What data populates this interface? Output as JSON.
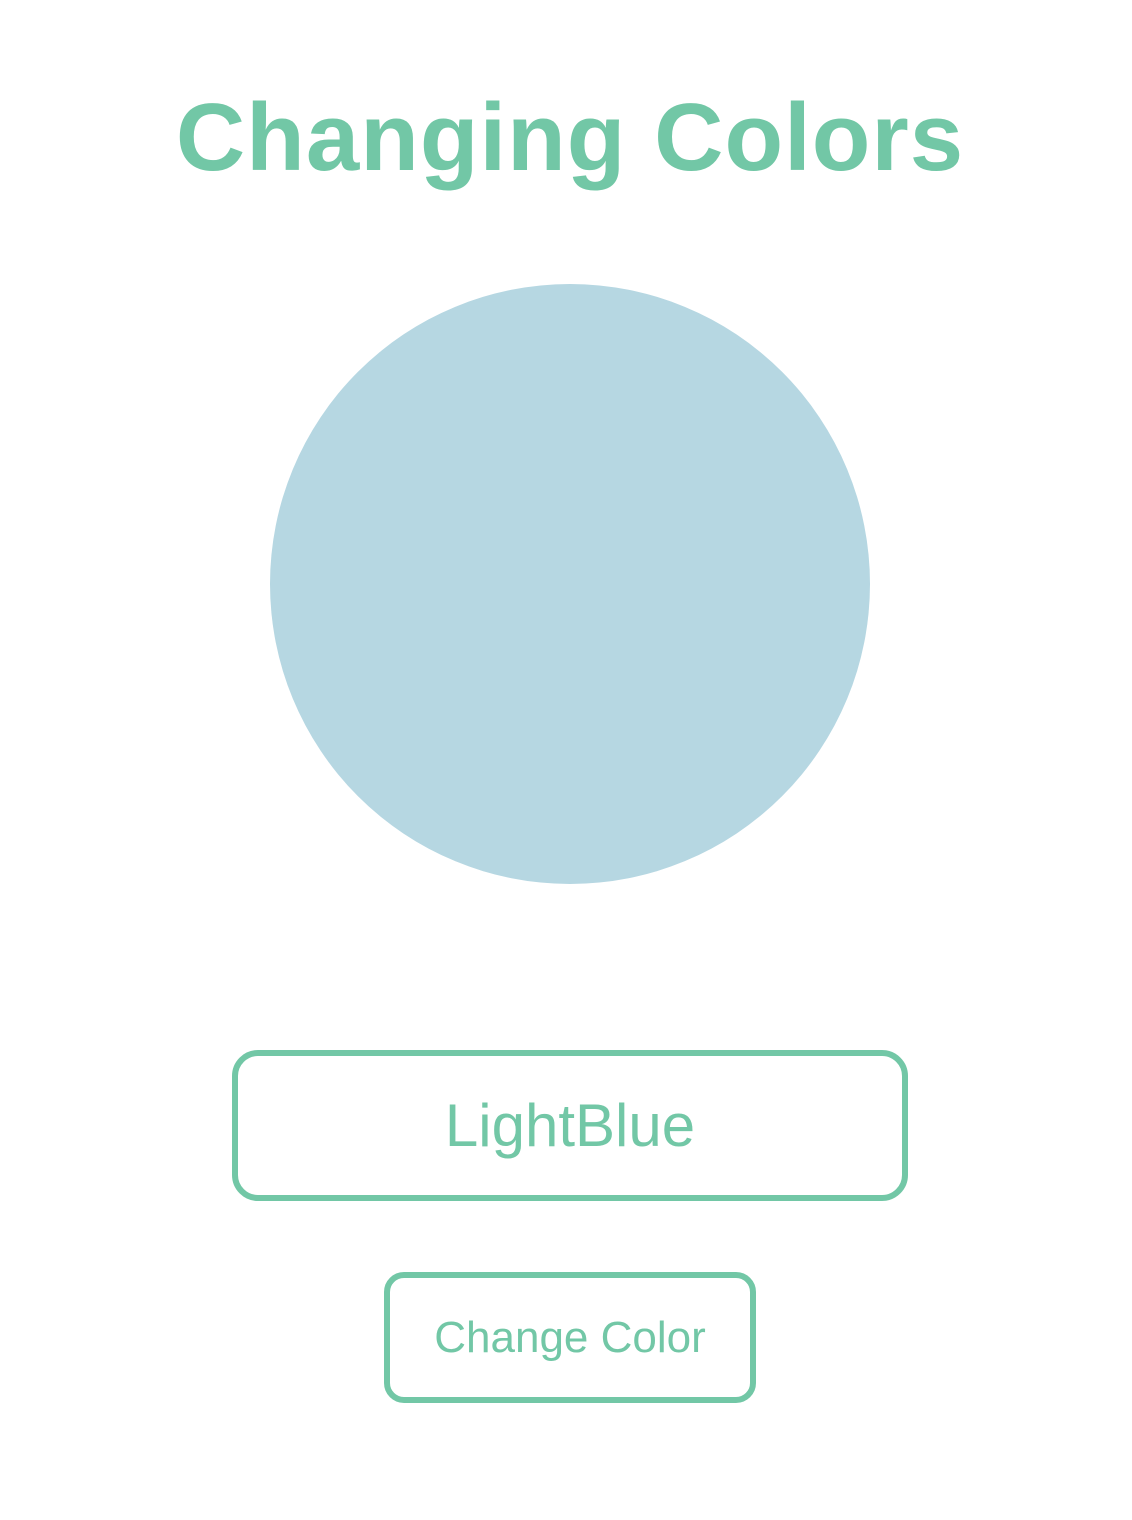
{
  "page": {
    "title": "Changing Colors"
  },
  "circle": {
    "color": "#b6d7e2"
  },
  "color_input": {
    "value": "LightBlue"
  },
  "button": {
    "label": "Change Color"
  },
  "theme": {
    "accent": "#72c7a6",
    "background": "#ffffff"
  }
}
